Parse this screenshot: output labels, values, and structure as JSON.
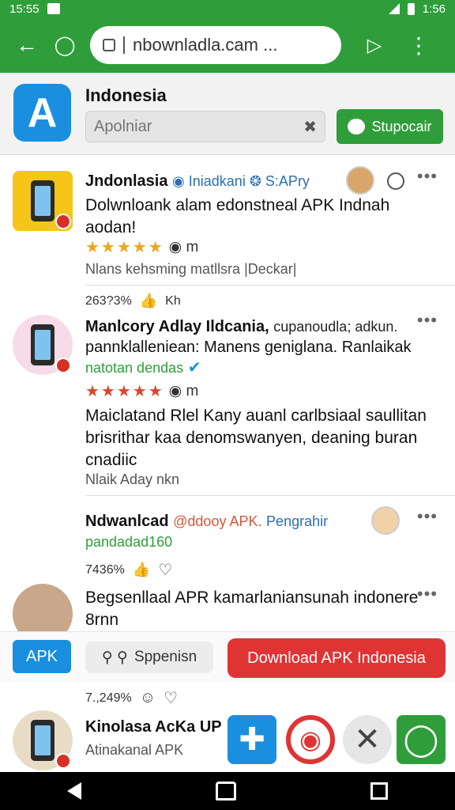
{
  "status": {
    "time": "15:55",
    "clock": "1:56"
  },
  "browser": {
    "url": "nbownladla.cam ..."
  },
  "header": {
    "title": "Indonesia",
    "search_placeholder": "Apolniar",
    "support_label": "Stupocair"
  },
  "posts": [
    {
      "author": "Jndonlasia",
      "meta1": "Iniadkani",
      "meta2": "S:APry",
      "text": "Dolwnloank alam edonstneal APK Indnah aodan!",
      "rating_suffix": "m",
      "sub": "Nlans kehsming matllsra  |Deckar|",
      "stat": "263?3%",
      "stat_suffix": "Kh"
    },
    {
      "author": "Manlcory Adlay Ildcania,",
      "meta1": "cupanoudla; adkun.",
      "line2": "pannklalleniean: Manens geniglana. Ranlaikak",
      "line3": "natotan dendas",
      "rating_suffix": "m",
      "text": "Maiclatand Rlel Kany auanl carlbsiaal saullitan brisrithar kaa denomswanyen, deaning buran cnadiic",
      "sub": "Nlaik Aday nkn"
    },
    {
      "author": "Ndwanlcad",
      "meta1": "@ddooy APK.",
      "meta2": "Pengrahir",
      "line2": "pandadad160",
      "stat": "7436%"
    },
    {
      "text": "Begsenllaal APR kamarlaniansunah indonere 8rnn"
    },
    {
      "stat": "7.,249%",
      "author": "Kinolasa AcKa UP",
      "sub": "Atinakanal APK"
    }
  ],
  "actions": {
    "apk_label": "APK",
    "spp_label": "Sppenisn",
    "download_label": "Download APK Indonesia"
  },
  "colors": {
    "brand_green": "#2f9e3a",
    "accent_blue": "#1a8fe0",
    "cta_red": "#e03434"
  }
}
